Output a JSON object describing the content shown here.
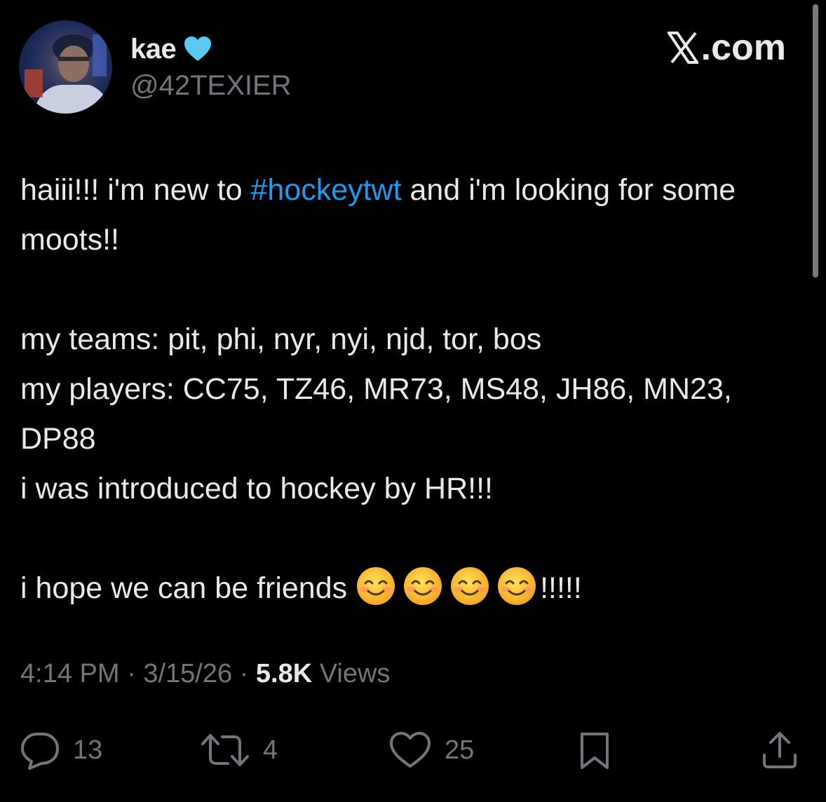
{
  "author": {
    "display_name": "kae",
    "handle": "@42TEXIER",
    "verified_heart_color": "#5bc8f0",
    "avatar_icon": "hockey-player-avatar"
  },
  "brand": {
    "label": ".com",
    "logo_icon": "x-logo-icon"
  },
  "tweet": {
    "line1_a": "haiii!!! i'm new to ",
    "hashtag": "#hockeytwt",
    "line1_b": " and i'm looking for some moots!!",
    "teams": "my teams: pit, phi, nyr, nyi, njd, tor, bos",
    "players": "my players: CC75, TZ46, MR73, MS48, JH86, MN23, DP88",
    "introduced": "i was introduced to hockey by HR!!!",
    "friends_text": "i hope we can be friends ",
    "friends_end": "!!!!!",
    "emoji_icon": "smiling-face-with-smiling-eyes-icon"
  },
  "meta": {
    "time": "4:14 PM",
    "sep1": " · ",
    "date": "3/15/26",
    "sep2": " · ",
    "views_count": "5.8K",
    "views_label": " Views"
  },
  "actions": {
    "replies": "13",
    "reposts": "4",
    "likes": "25"
  },
  "colors": {
    "background": "#000000",
    "text": "#e7e9ea",
    "secondary": "#71767b",
    "link": "#1d9bf0"
  }
}
